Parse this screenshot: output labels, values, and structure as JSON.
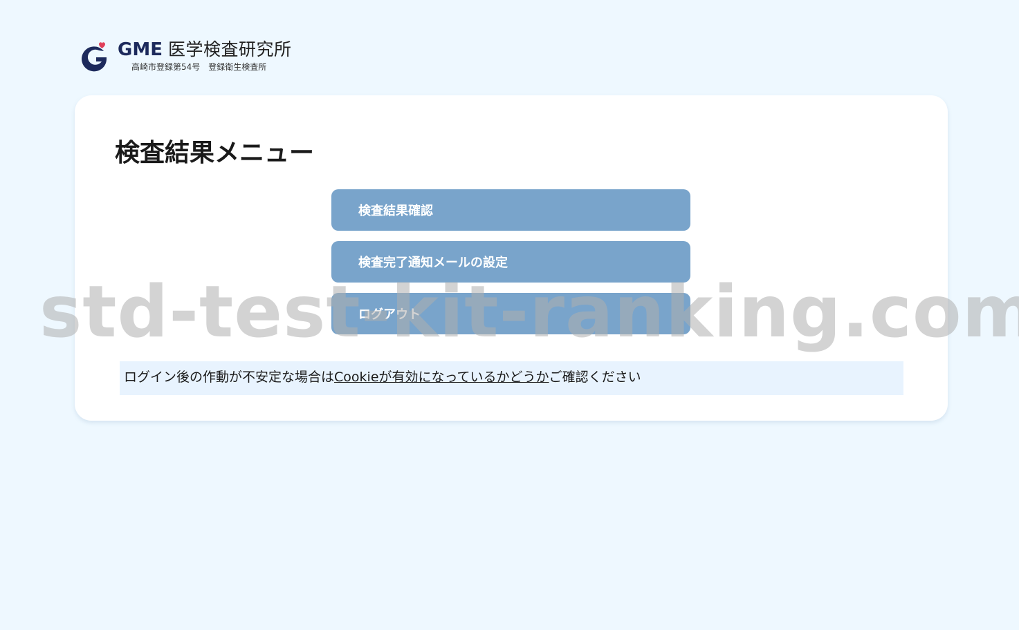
{
  "brand": {
    "logo_letter": "G",
    "name": "GME",
    "name_jp": "医学検査研究所",
    "subtitle": "高崎市登録第54号　登録衛生検査所",
    "colors": {
      "navy": "#1d2a5c",
      "heart": "#e0405a"
    }
  },
  "page": {
    "title": "検査結果メニュー"
  },
  "menu": {
    "items": [
      {
        "label": "検査結果確認"
      },
      {
        "label": "検査完了通知メールの設定"
      },
      {
        "label": "ログアウト"
      }
    ],
    "button_color": "#79a4cb"
  },
  "notice": {
    "prefix": "ログイン後の作動が不安定な場合は",
    "link_text": "Cookieが有効になっているかどうか",
    "suffix": "ご確認ください"
  },
  "watermark": {
    "text": "std-test-kit-ranking.com"
  }
}
